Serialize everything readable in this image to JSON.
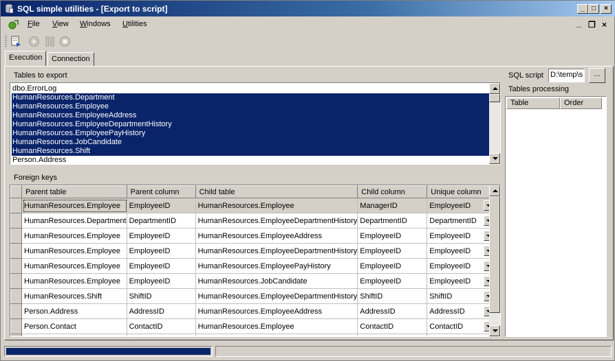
{
  "window": {
    "title": "SQL simple utilities - [Export to script]",
    "controls": {
      "minimize": "_",
      "maximize": "□",
      "close": "×"
    }
  },
  "menu": {
    "items": [
      {
        "key": "F",
        "rest": "ile"
      },
      {
        "key": "V",
        "rest": "iew"
      },
      {
        "key": "W",
        "rest": "indows"
      },
      {
        "key": "U",
        "rest": "tilities"
      }
    ],
    "mdi_controls": {
      "minimize": "_",
      "restore": "❐",
      "close": "×"
    }
  },
  "toolbar": {
    "icons": [
      "export-script-icon",
      "run-icon",
      "pause-icon",
      "stop-icon"
    ]
  },
  "tabs": [
    {
      "label": "Execution",
      "active": true
    },
    {
      "label": "Connection",
      "active": false
    }
  ],
  "tables_to_export": {
    "label": "Tables to export",
    "items": [
      {
        "text": "dbo.ErrorLog",
        "selected": false
      },
      {
        "text": "HumanResources.Department",
        "selected": true
      },
      {
        "text": "HumanResources.Employee",
        "selected": true
      },
      {
        "text": "HumanResources.EmployeeAddress",
        "selected": true
      },
      {
        "text": "HumanResources.EmployeeDepartmentHistory",
        "selected": true
      },
      {
        "text": "HumanResources.EmployeePayHistory",
        "selected": true
      },
      {
        "text": "HumanResources.JobCandidate",
        "selected": true
      },
      {
        "text": "HumanResources.Shift",
        "selected": true
      },
      {
        "text": "Person.Address",
        "selected": false
      }
    ]
  },
  "foreign_keys": {
    "label": "Foreign keys",
    "columns": [
      "Parent table",
      "Parent column",
      "Child table",
      "Child column",
      "Unique column"
    ],
    "rows": [
      [
        "HumanResources.Employee",
        "EmployeeID",
        "HumanResources.Employee",
        "ManagerID",
        "EmployeeID"
      ],
      [
        "HumanResources.Department",
        "DepartmentID",
        "HumanResources.EmployeeDepartmentHistory",
        "DepartmentID",
        "DepartmentID"
      ],
      [
        "HumanResources.Employee",
        "EmployeeID",
        "HumanResources.EmployeeAddress",
        "EmployeeID",
        "EmployeeID"
      ],
      [
        "HumanResources.Employee",
        "EmployeeID",
        "HumanResources.EmployeeDepartmentHistory",
        "EmployeeID",
        "EmployeeID"
      ],
      [
        "HumanResources.Employee",
        "EmployeeID",
        "HumanResources.EmployeePayHistory",
        "EmployeeID",
        "EmployeeID"
      ],
      [
        "HumanResources.Employee",
        "EmployeeID",
        "HumanResources.JobCandidate",
        "EmployeeID",
        "EmployeeID"
      ],
      [
        "HumanResources.Shift",
        "ShiftID",
        "HumanResources.EmployeeDepartmentHistory",
        "ShiftID",
        "ShiftID"
      ],
      [
        "Person.Address",
        "AddressID",
        "HumanResources.EmployeeAddress",
        "AddressID",
        "AddressID"
      ],
      [
        "Person.Contact",
        "ContactID",
        "HumanResources.Employee",
        "ContactID",
        "ContactID"
      ]
    ]
  },
  "sql_script": {
    "label": "SQL script",
    "value": "D:\\temp\\s",
    "browse_label": "..."
  },
  "tables_processing": {
    "label": "Tables processing",
    "columns": [
      "Table",
      "Order"
    ]
  },
  "status": {
    "progress": 1.0
  },
  "colors": {
    "selection": "#0a246a",
    "face": "#d4d0c8"
  }
}
